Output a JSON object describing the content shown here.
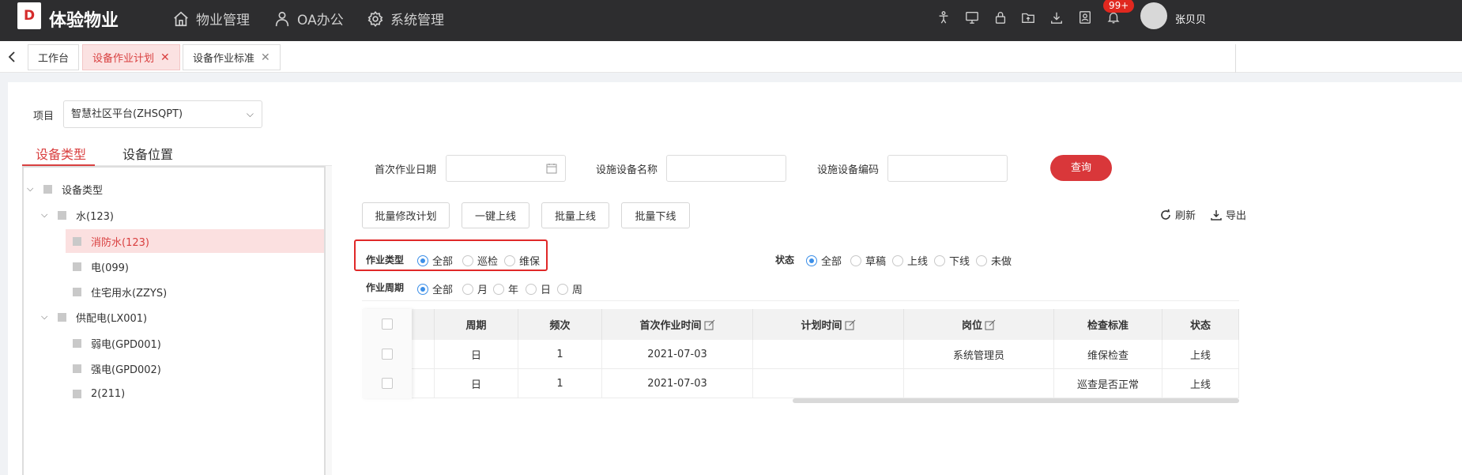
{
  "header": {
    "logo_mark": "D",
    "brand": "体验物业",
    "nav": [
      {
        "label": "物业管理",
        "icon": "home-icon"
      },
      {
        "label": "OA办公",
        "icon": "user-icon"
      },
      {
        "label": "系统管理",
        "icon": "gear-icon"
      }
    ],
    "notifications_badge": "99+",
    "username": "张贝贝"
  },
  "tabs": [
    {
      "label": "工作台",
      "active": false,
      "closable": false
    },
    {
      "label": "设备作业计划",
      "active": true,
      "closable": true
    },
    {
      "label": "设备作业标准",
      "active": false,
      "closable": true
    }
  ],
  "left_panel": {
    "project_label": "项目",
    "project_value": "智慧社区平台(ZHSQPT)",
    "tree_tabs": [
      "设备类型",
      "设备位置"
    ],
    "tree": [
      {
        "label": "设备类型",
        "level": 0,
        "expanded": true
      },
      {
        "label": "水(123)",
        "level": 1,
        "expanded": true
      },
      {
        "label": "消防水(123)",
        "level": 2,
        "selected": true
      },
      {
        "label": "电(099)",
        "level": 2
      },
      {
        "label": "住宅用水(ZZYS)",
        "level": 2
      },
      {
        "label": "供配电(LX001)",
        "level": 1,
        "expanded": true
      },
      {
        "label": "弱电(GPD001)",
        "level": 2
      },
      {
        "label": "强电(GPD002)",
        "level": 2
      },
      {
        "label": "2(211)",
        "level": 2
      }
    ]
  },
  "filters": {
    "first_date_label": "首次作业日期",
    "device_name_label": "设施设备名称",
    "device_code_label": "设施设备编码",
    "query_button": "查询"
  },
  "actions": {
    "batch_edit": "批量修改计划",
    "one_click_online": "一键上线",
    "batch_online": "批量上线",
    "batch_offline": "批量下线",
    "refresh": "刷新",
    "export": "导出"
  },
  "radios": {
    "work_type": {
      "label": "作业类型",
      "options": [
        "全部",
        "巡检",
        "维保"
      ],
      "selected": "全部"
    },
    "status": {
      "label": "状态",
      "options": [
        "全部",
        "草稿",
        "上线",
        "下线",
        "未做"
      ],
      "selected": "全部"
    },
    "work_cycle": {
      "label": "作业周期",
      "options": [
        "全部",
        "月",
        "年",
        "日",
        "周"
      ],
      "selected": "全部"
    }
  },
  "table": {
    "columns": [
      "周期",
      "频次",
      "首次作业时间",
      "计划时间",
      "岗位",
      "检查标准",
      "状态"
    ],
    "rows": [
      {
        "cycle": "日",
        "freq": "1",
        "first_time": "2021-07-03",
        "plan_time": "",
        "post": "系统管理员",
        "standard": "维保检查",
        "status": "上线"
      },
      {
        "cycle": "日",
        "freq": "1",
        "first_time": "2021-07-03",
        "plan_time": "",
        "post": "",
        "standard": "巡查是否正常",
        "status": "上线"
      }
    ]
  }
}
